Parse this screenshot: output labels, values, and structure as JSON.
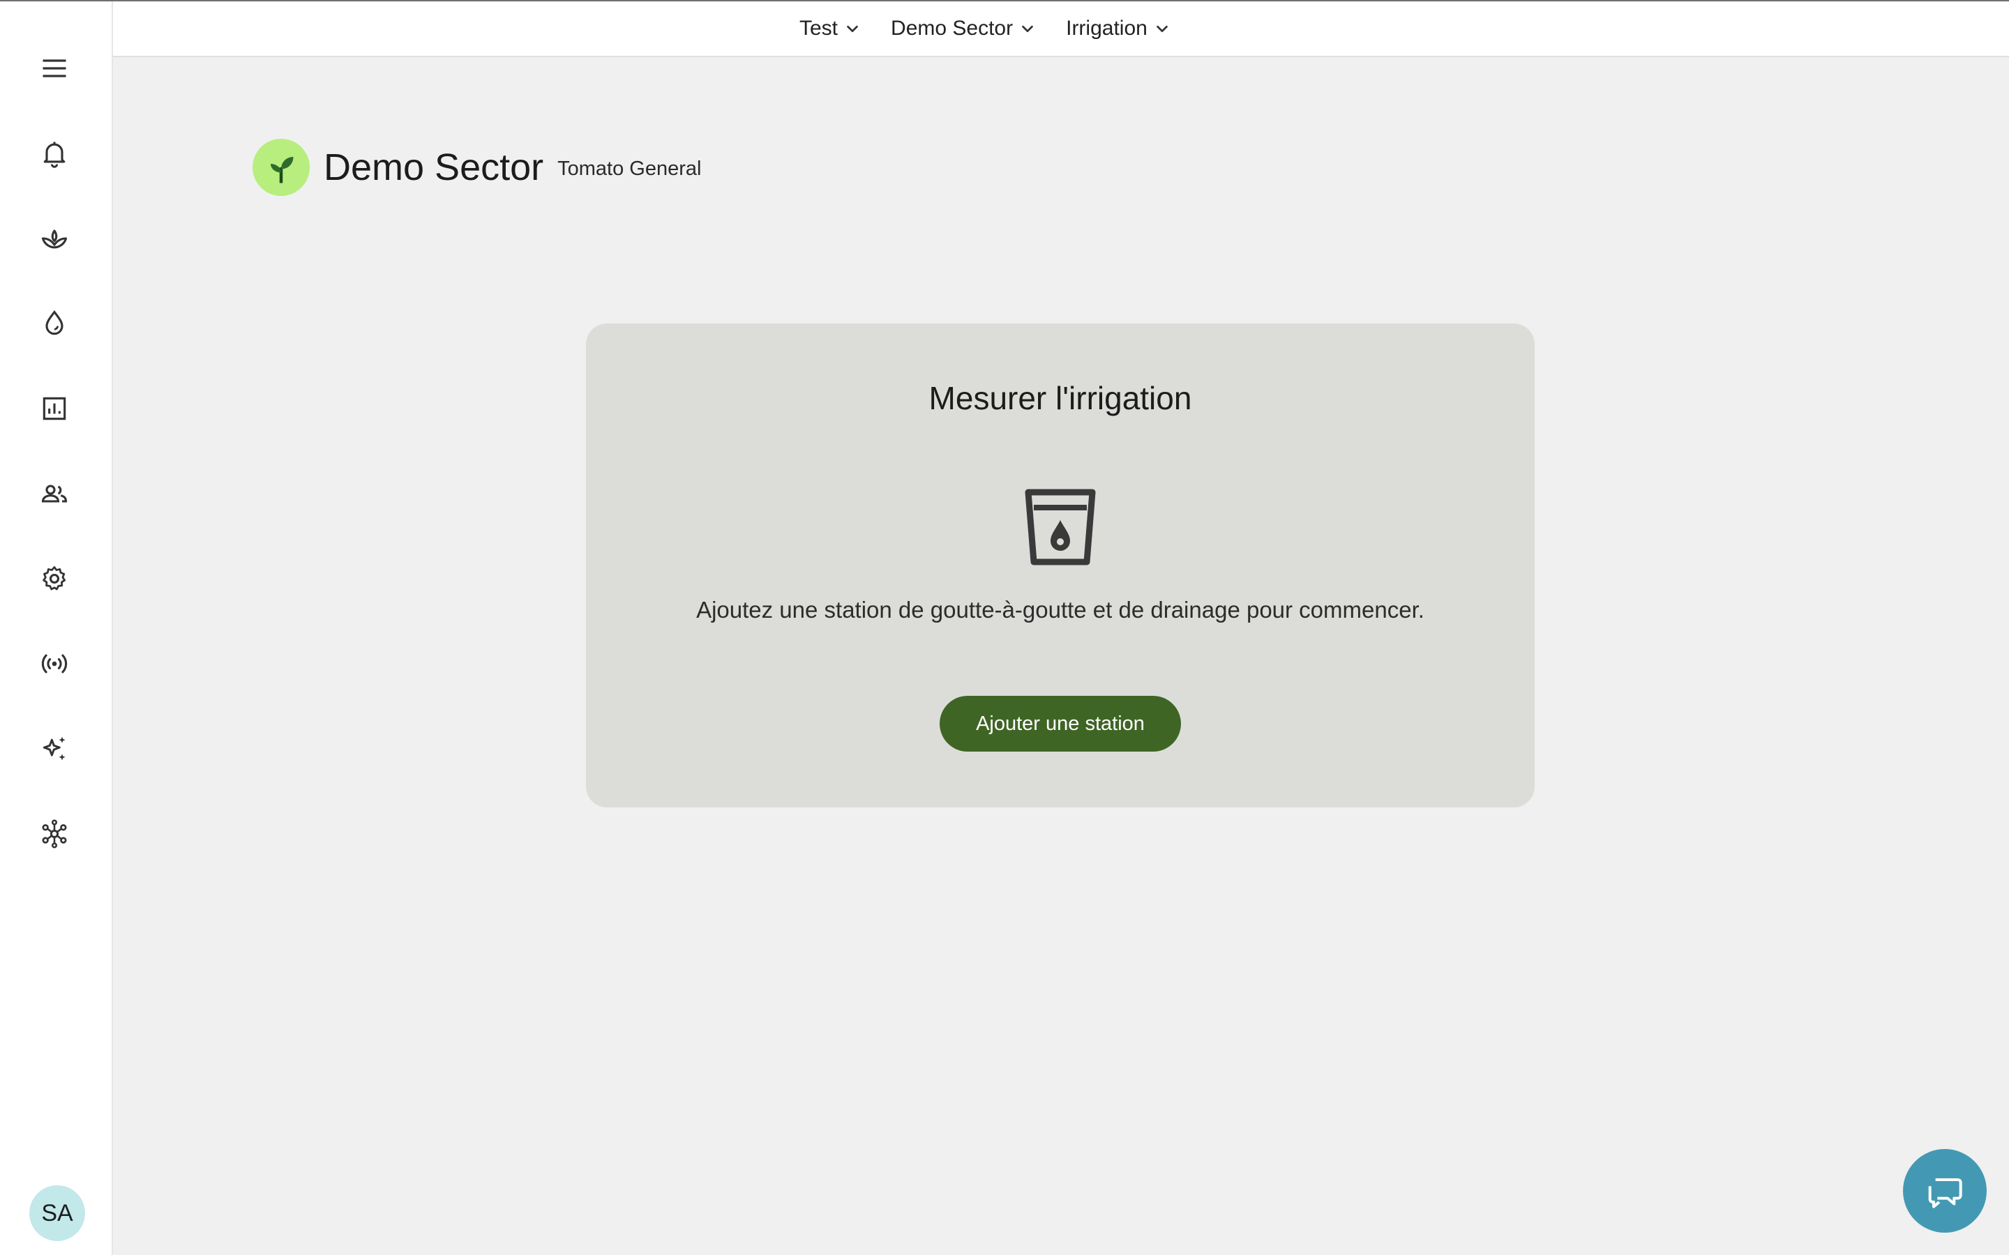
{
  "topbar": {
    "crumbs": [
      {
        "label": "Test",
        "icon": "chevron-down-icon"
      },
      {
        "label": "Demo Sector",
        "icon": "chevron-down-icon"
      },
      {
        "label": "Irrigation",
        "icon": "chevron-down-icon"
      }
    ]
  },
  "sidebar": {
    "icons": [
      "menu-icon",
      "bell-icon",
      "sprout-icon",
      "drop-icon",
      "chart-icon",
      "users-icon",
      "gear-icon",
      "broadcast-icon",
      "sparkle-icon",
      "network-icon"
    ],
    "avatar_initials": "SA"
  },
  "header": {
    "title": "Demo Sector",
    "subtitle": "Tomato General",
    "logo_icon": "sprout-icon"
  },
  "card": {
    "title": "Mesurer l'irrigation",
    "icon": "water-cup-icon",
    "message": "Ajoutez une station de goutte-à-goutte et de drainage pour commencer.",
    "button_label": "Ajouter une station"
  },
  "chat": {
    "icon": "chat-icon"
  },
  "colors": {
    "accent_button": "#3f6525",
    "logo_bg": "#b7ee7e",
    "chat_bg": "#4399b3",
    "avatar_bg": "#c2e8ea",
    "card_bg": "#dcddd9",
    "page_bg": "#f0f0f0"
  }
}
